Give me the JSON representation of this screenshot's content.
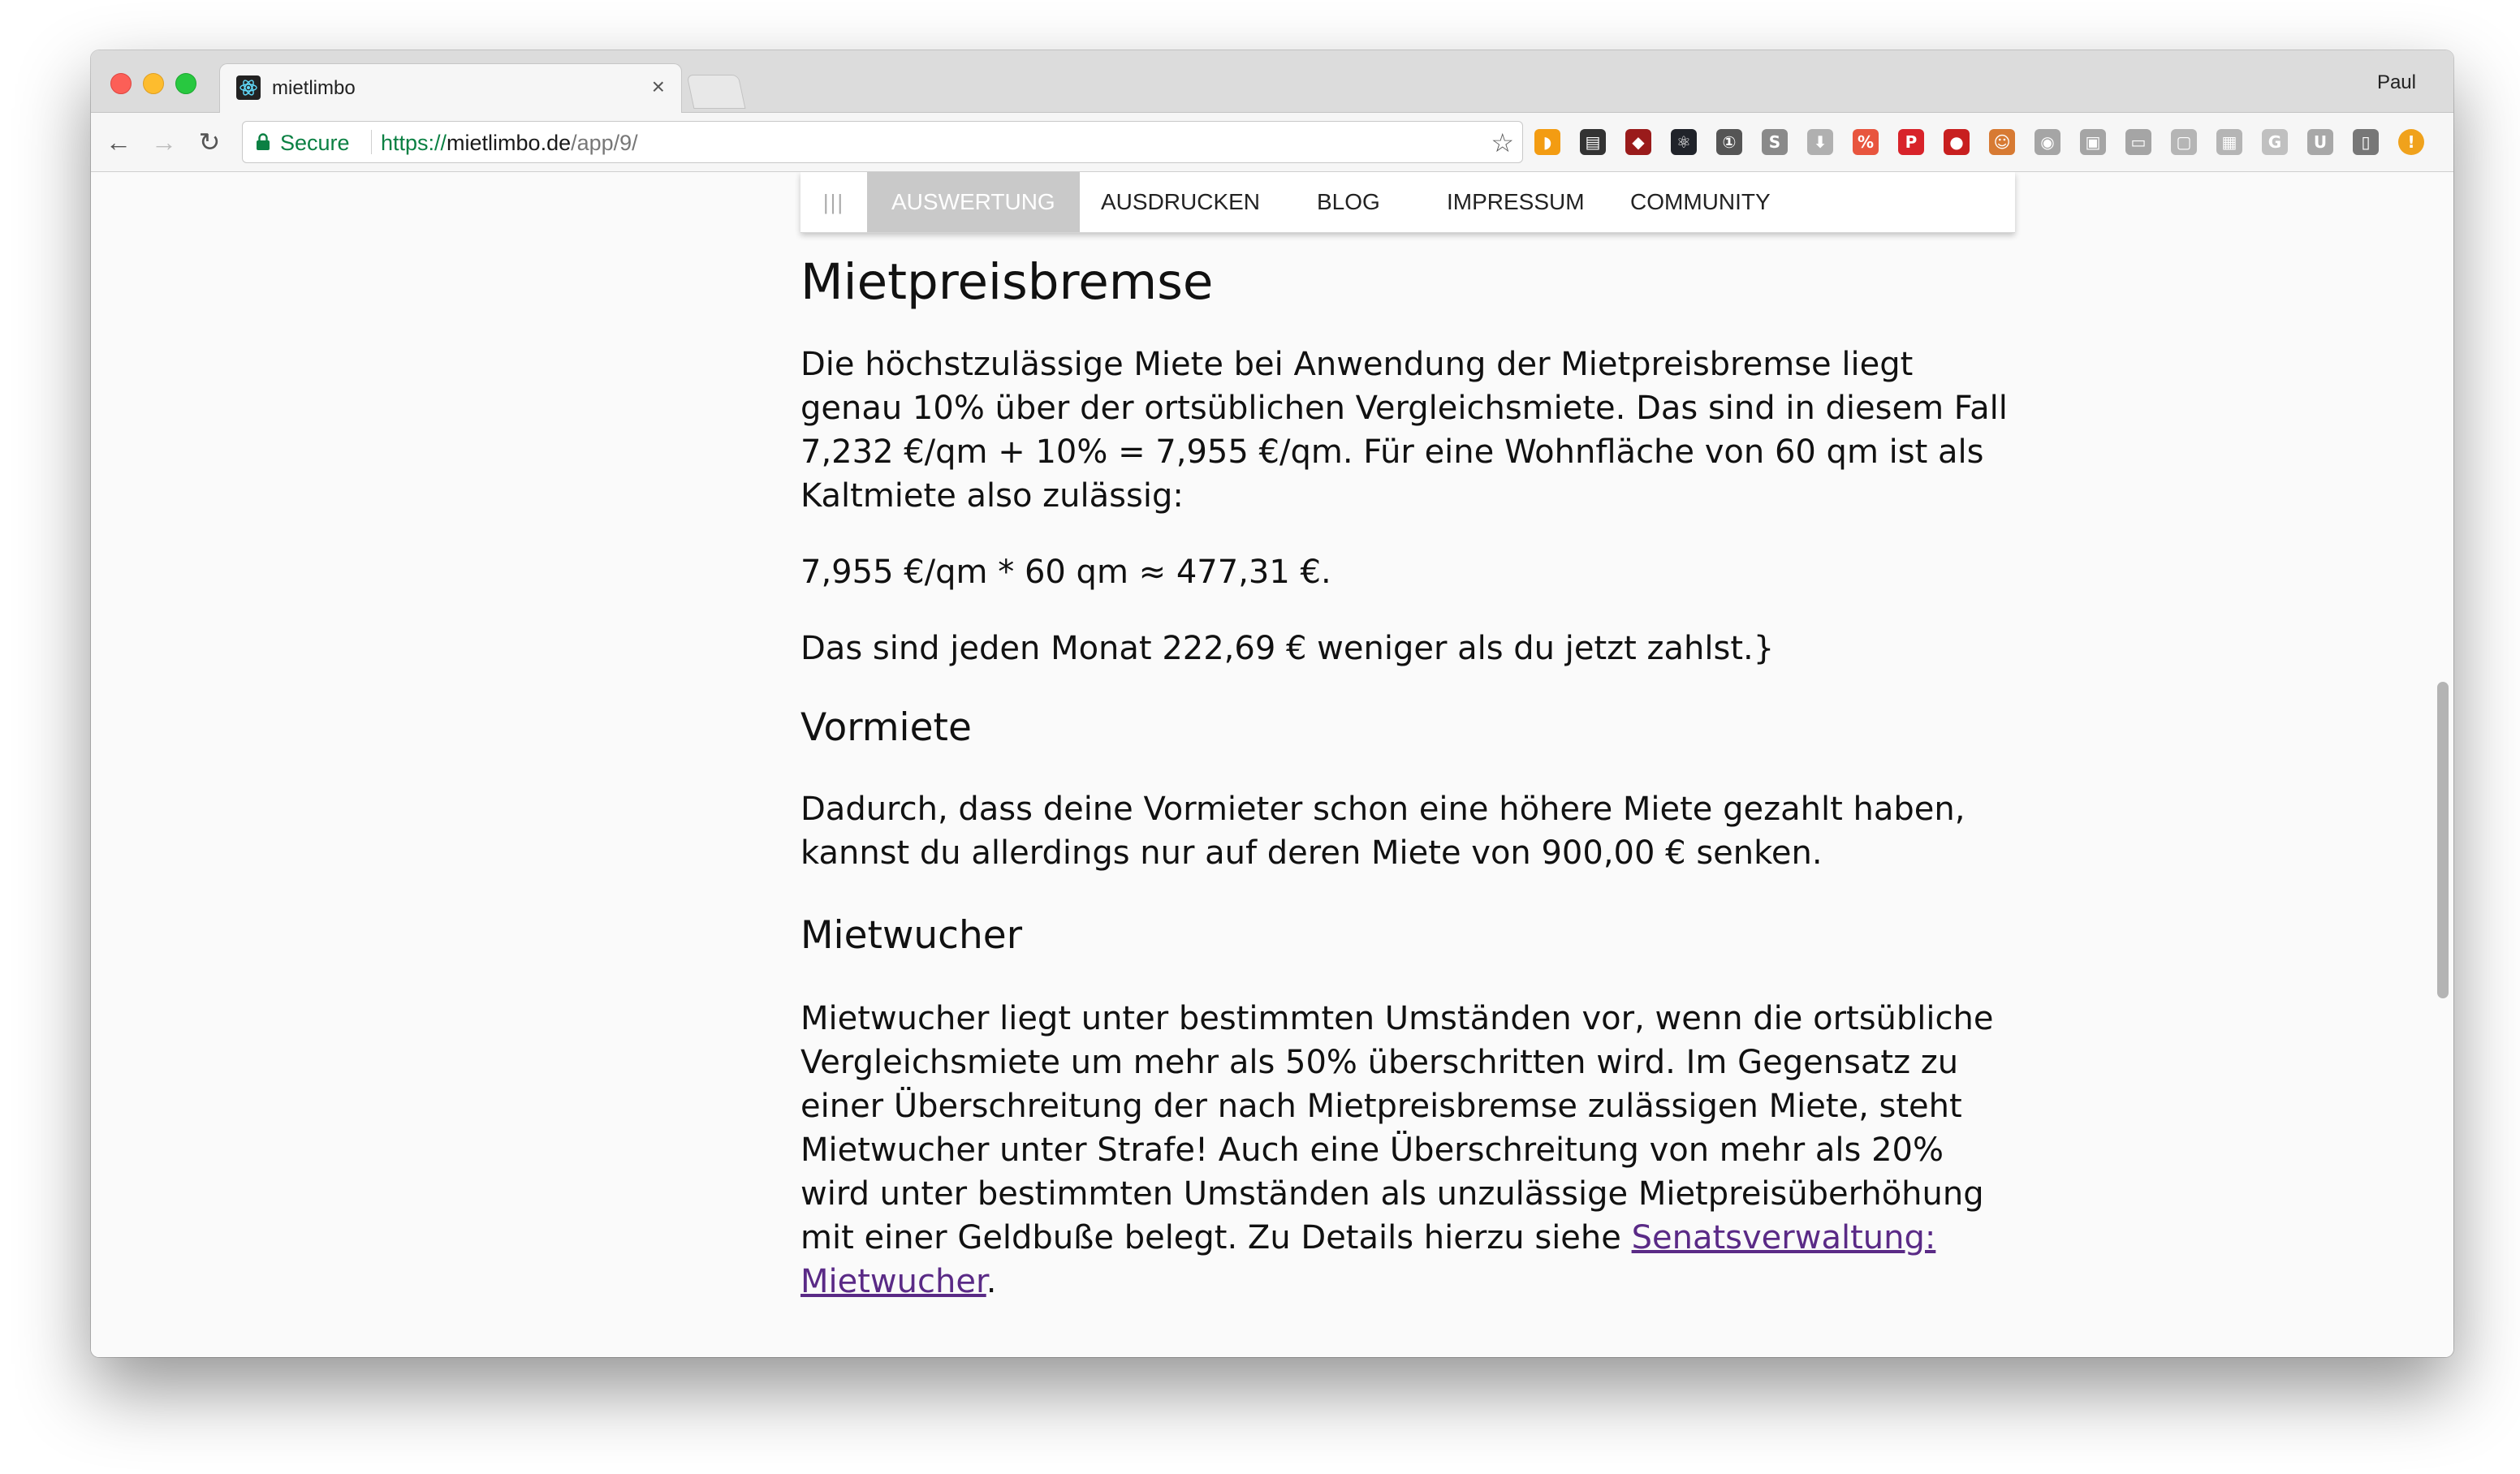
{
  "browser": {
    "tab_title": "mietlimbo",
    "tab_close": "×",
    "profile_name": "Paul",
    "secure_label": "Secure",
    "url_scheme": "https://",
    "url_host": "mietlimbo.de",
    "url_path": "/app/9/",
    "extension_icons": [
      "rss-icon",
      "feedly-icon",
      "ublock-icon",
      "react-devtools-icon",
      "onepassword-icon",
      "skype-icon",
      "download-icon",
      "wappalyzer-icon",
      "pinterest-icon",
      "lastpass-icon",
      "ghostery-icon",
      "reddit-icon",
      "camera-icon",
      "screenshot-icon",
      "comment-icon",
      "caption-icon",
      "gif-icon",
      "cup-icon",
      "device-icon",
      "warning-icon"
    ]
  },
  "nav": {
    "menu_icon": "|||",
    "items": [
      "AUSWERTUNG",
      "AUSDRUCKEN",
      "BLOG",
      "IMPRESSUM",
      "COMMUNITY"
    ],
    "active_index": 0
  },
  "content": {
    "h1": "Mietpreisbremse",
    "p1": "Die höchstzulässige Miete bei Anwendung der Mietpreisbremse liegt genau 10% über der ortsüblichen Vergleichsmiete. Das sind in diesem Fall 7,232 €/qm + 10% = 7,955 €/qm. Für eine Wohnfläche von 60 qm ist als Kaltmiete also zulässig:",
    "formula": "7,955 €/qm * 60 qm ≈ 477,31 €.",
    "p2": "Das sind jeden Monat 222,69 € weniger als du jetzt zahlst.}",
    "h2_vormiete": "Vormiete",
    "p_vormiete": "Dadurch, dass deine Vormieter schon eine höhere Miete gezahlt haben, kannst du allerdings nur auf deren Miete von 900,00 € senken.",
    "h2_mietwucher": "Mietwucher",
    "p_mietwucher": "Mietwucher liegt unter bestimmten Umständen vor, wenn die ortsübliche Vergleichsmiete um mehr als 50% überschritten wird. Im Gegensatz zu einer Überschreitung der nach Mietpreisbremse zulässigen Miete, steht Mietwucher unter Strafe! Auch eine Überschreitung von mehr als 20% wird unter bestimmten Umständen als unzulässige Mietpreisüberhöhung mit einer Geldbuße belegt. Zu Details hierzu siehe",
    "link_text": "Senatsverwaltung: Mietwucher",
    "p_mietwucher_end": "."
  }
}
